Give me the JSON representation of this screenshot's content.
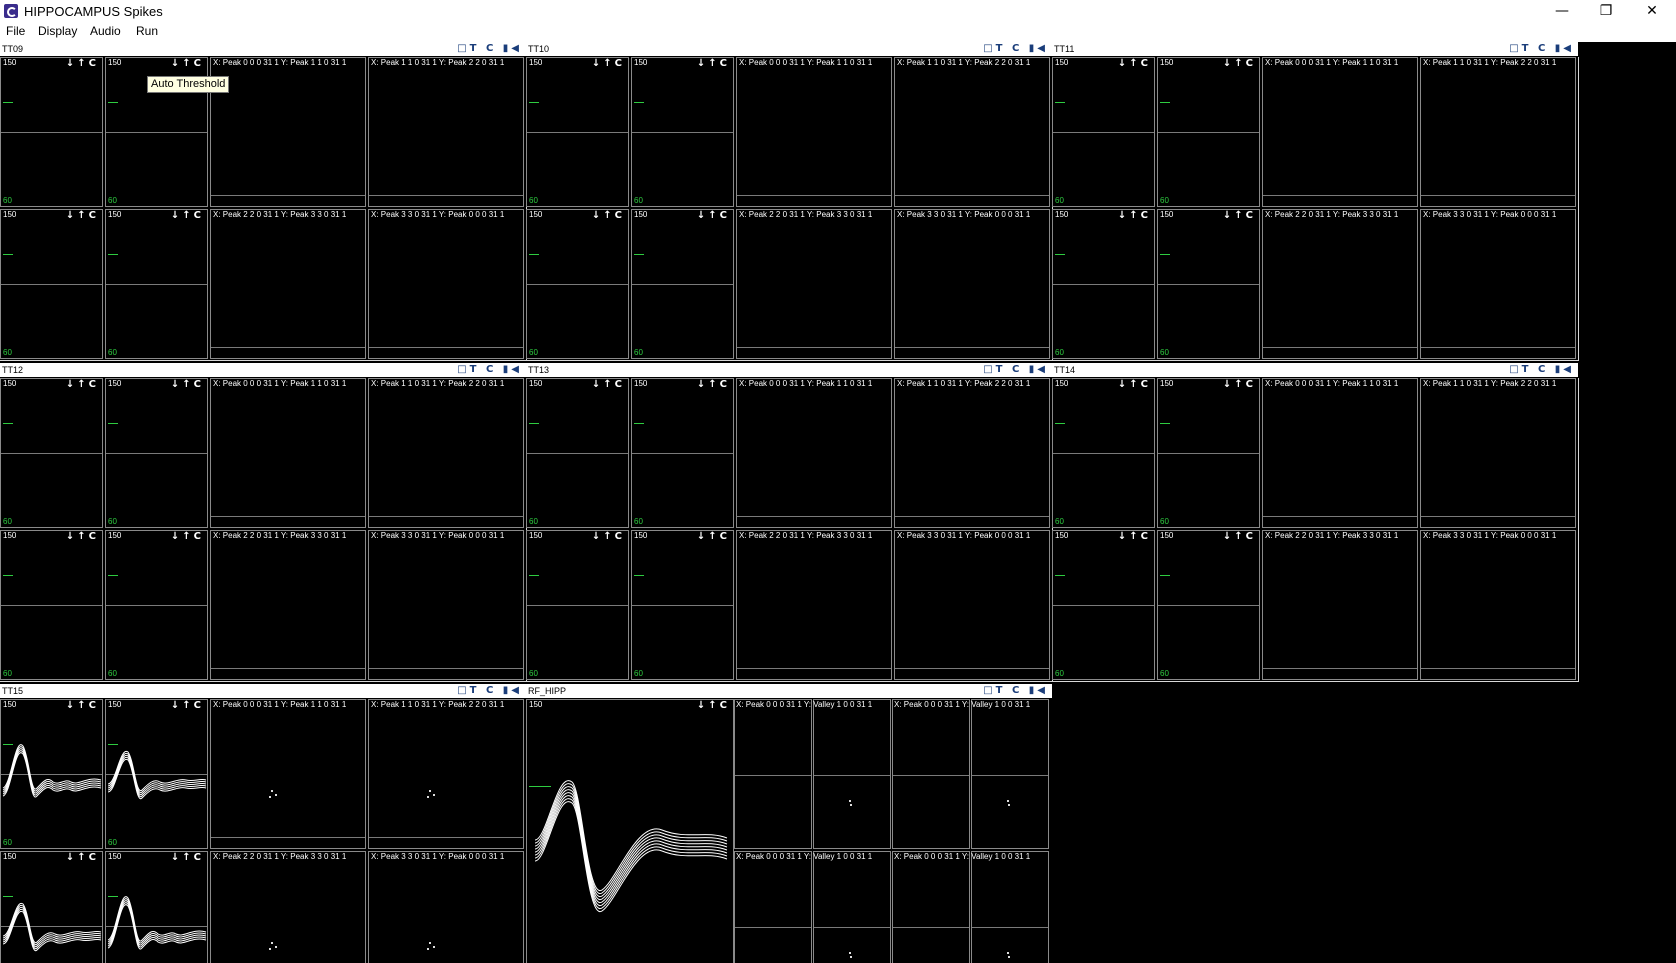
{
  "window": {
    "title": "HIPPOCAMPUS Spikes",
    "minimize": "—",
    "restore": "❐",
    "close": "✕"
  },
  "menu": [
    "File",
    "Display",
    "Audio",
    "Run"
  ],
  "tooltip": "Auto Threshold",
  "tool_glyphs": "□T C ▮◀",
  "wave_controls": "↓↑C",
  "wave_axis": {
    "max": "150",
    "min": "60"
  },
  "tetrodes": [
    {
      "name": "TT09",
      "active": false
    },
    {
      "name": "TT10",
      "active": false
    },
    {
      "name": "TT11",
      "active": false
    },
    {
      "name": "TT12",
      "active": false
    },
    {
      "name": "TT13",
      "active": false
    },
    {
      "name": "TT14",
      "active": false
    },
    {
      "name": "TT15",
      "active": true
    }
  ],
  "feature_labels": [
    "X: Peak 0 0 0 31 1   Y: Peak 1 1 0 31 1",
    "X: Peak 1 1 0 31 1   Y: Peak 2 2 0 31 1",
    "X: Peak 2 2 0 31 1   Y: Peak 3 3 0 31 1",
    "X: Peak 3 3 0 31 1   Y: Peak 0 0 0 31 1"
  ],
  "rf": {
    "name": "RF_HIPP",
    "feature_labels": [
      "X: Peak 0 0 0 31 1   Y: Valley 1 0 0 31 1",
      "X: Peak 0 0 0 31 1   Y: Valley 1 0 0 31 1",
      "X: Peak 0 0 0 31 1   Y: Valley 1 0 0 31 1",
      "X: Peak 0 0 0 31 1   Y: Valley 1 0 0 31 1"
    ]
  }
}
